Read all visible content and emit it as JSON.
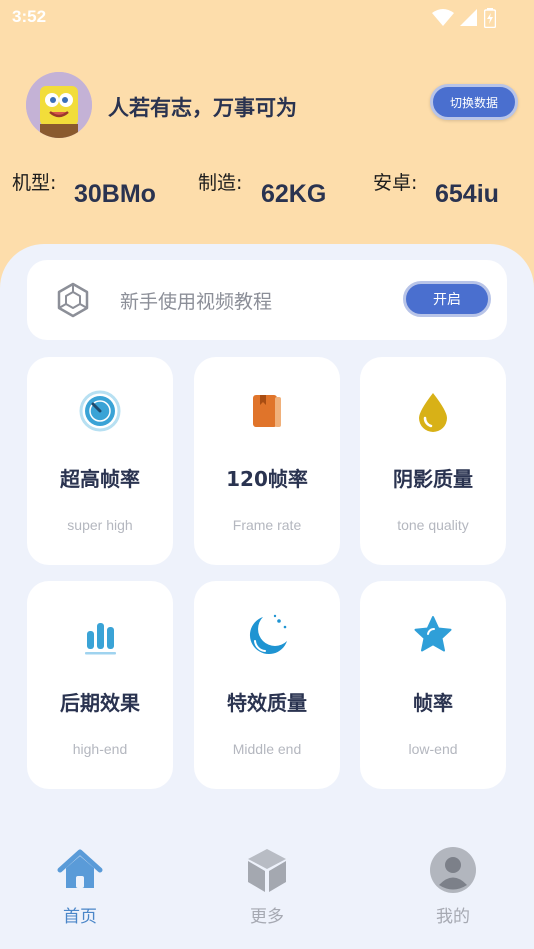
{
  "status_bar": {
    "time": "3:52"
  },
  "profile": {
    "title": "人若有志，万事可为",
    "switch_label": "切换数据"
  },
  "stats": [
    {
      "label": "机型:",
      "value": "30BMo"
    },
    {
      "label": "制造:",
      "value": "62KG"
    },
    {
      "label": "安卓:",
      "value": "654iu"
    }
  ],
  "tutorial": {
    "text": "新手使用视频教程",
    "button_label": "开启"
  },
  "cards": [
    {
      "title": "超高帧率",
      "subtitle": "super high",
      "icon": "stopwatch-icon",
      "color": "#3aa3d6"
    },
    {
      "title": "120帧率",
      "subtitle": "Frame rate",
      "icon": "book-icon",
      "color": "#e0742a"
    },
    {
      "title": "阴影质量",
      "subtitle": "tone quality",
      "icon": "drop-icon",
      "color": "#d8b117"
    },
    {
      "title": "后期效果",
      "subtitle": "high-end",
      "icon": "bar-chart-icon",
      "color": "#3aa3d6"
    },
    {
      "title": "特效质量",
      "subtitle": "Middle end",
      "icon": "moon-icon",
      "color": "#1f94d2"
    },
    {
      "title": "帧率",
      "subtitle": "low-end",
      "icon": "star-icon",
      "color": "#2f9fd8"
    }
  ],
  "nav": [
    {
      "label": "首页",
      "icon": "home-icon",
      "active": true
    },
    {
      "label": "更多",
      "icon": "cube-icon",
      "active": false
    },
    {
      "label": "我的",
      "icon": "user-icon",
      "active": false
    }
  ]
}
